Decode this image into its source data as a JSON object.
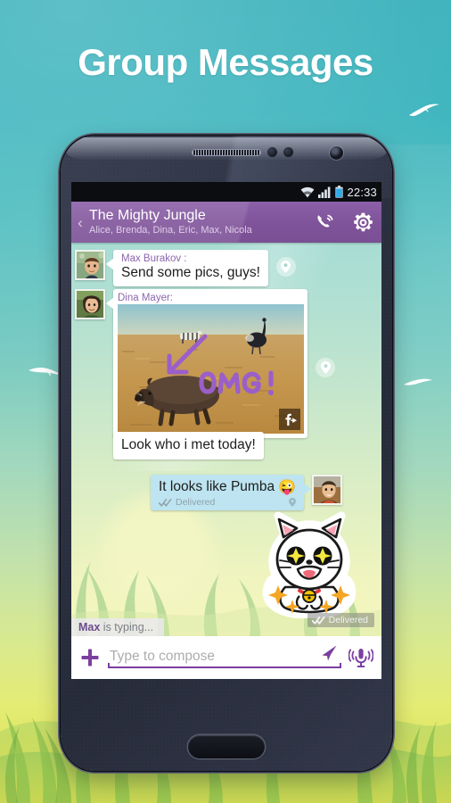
{
  "promo": {
    "headline": "Group Messages",
    "background_top_color": "#3fb3bd",
    "background_bottom_color": "#d2d94f",
    "decorations": [
      "bird-icon",
      "bird-icon",
      "bird-icon",
      "grass-illustration"
    ]
  },
  "device": {
    "kind": "android-phone",
    "parts": [
      "earpiece-speaker",
      "proximity-sensor",
      "front-camera",
      "home-button"
    ]
  },
  "statusbar": {
    "time": "22:33",
    "icons": [
      "wifi-icon",
      "cellular-signal-icon",
      "battery-icon"
    ]
  },
  "actionbar": {
    "back_label": "‹",
    "title": "The Mighty Jungle",
    "subtitle": "Alice, Brenda, Dina, Eric, Max, Nicola",
    "call_icon": "phone-call-icon",
    "settings_icon": "gear-icon",
    "accent_color": "#7f5399"
  },
  "messages": [
    {
      "id": "m1",
      "direction": "incoming",
      "sender": "Max Burakov :",
      "text": "Send some pics, guys!",
      "avatar": "avatar-max",
      "pin_icon": "location-pin-icon"
    },
    {
      "id": "m2",
      "direction": "incoming",
      "sender": "Dina Mayer:",
      "type": "photo",
      "photo_caption_drawing": "OMG!",
      "photo_subjects": [
        "warthog",
        "ostrich",
        "zebra",
        "savanna"
      ],
      "share_icon": "facebook-share-icon",
      "avatar": "avatar-dina",
      "pin_icon": "location-pin-icon"
    },
    {
      "id": "m3",
      "direction": "incoming",
      "text": "Look who i met today!"
    },
    {
      "id": "m4",
      "direction": "outgoing",
      "text": "It looks like Pumba",
      "emoji": "😜",
      "status": "Delivered",
      "status_icon": "double-check-icon",
      "pin_icon": "location-pin-icon",
      "avatar": "avatar-eric",
      "bubble_color": "#bde4f0"
    },
    {
      "id": "m5",
      "direction": "outgoing",
      "type": "sticker",
      "sticker_name": "sparkling-cat-sticker",
      "status": "Delivered",
      "status_icon": "double-check-icon"
    }
  ],
  "typing": {
    "who": "Max",
    "text": " is typing..."
  },
  "compose": {
    "add_icon": "plus-icon",
    "placeholder": "Type to compose",
    "value": "",
    "send_icon": "send-arrow-icon",
    "voice_icon": "microphone-icon",
    "accent_color": "#7b3fa0"
  }
}
